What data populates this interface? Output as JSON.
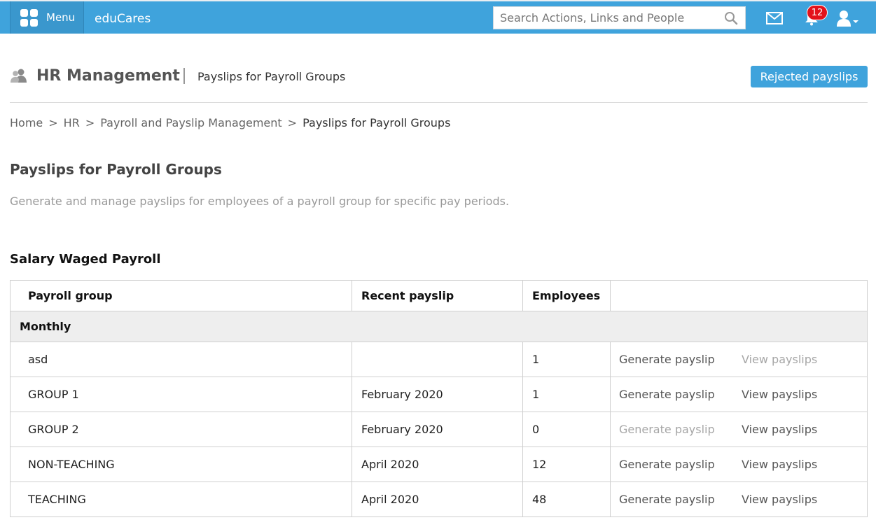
{
  "topbar": {
    "menu_label": "Menu",
    "app_name": "eduCares",
    "search_placeholder": "Search Actions, Links and People",
    "notification_count": "12",
    "icons": [
      "menu-grid-icon",
      "search-icon",
      "mail-icon",
      "bell-icon",
      "user-icon"
    ],
    "accent_color": "#3fa3dc"
  },
  "header": {
    "title": "HR Management",
    "subtitle": "Payslips for Payroll Groups",
    "rejected_button": "Rejected payslips"
  },
  "breadcrumb": [
    {
      "label": "Home"
    },
    {
      "label": "HR"
    },
    {
      "label": "Payroll and Payslip Management"
    },
    {
      "label": "Payslips for Payroll Groups"
    }
  ],
  "breadcrumb_sep": ">",
  "page": {
    "title": "Payslips for Payroll Groups",
    "description": "Generate and manage payslips for employees of a payroll group for specific pay periods."
  },
  "section": {
    "title": "Salary Waged Payroll"
  },
  "table": {
    "headers": [
      "Payroll group",
      "Recent payslip",
      "Employees",
      ""
    ],
    "group_label": "Monthly",
    "generate_label": "Generate payslip",
    "view_label": "View payslips",
    "rows": [
      {
        "name": "asd",
        "recent": "",
        "employees": "1",
        "generate_enabled": true,
        "view_enabled": false
      },
      {
        "name": "GROUP 1",
        "recent": "February 2020",
        "employees": "1",
        "generate_enabled": true,
        "view_enabled": true
      },
      {
        "name": "GROUP 2",
        "recent": "February 2020",
        "employees": "0",
        "generate_enabled": false,
        "view_enabled": true
      },
      {
        "name": "NON-TEACHING",
        "recent": "April 2020",
        "employees": "12",
        "generate_enabled": true,
        "view_enabled": true
      },
      {
        "name": "TEACHING",
        "recent": "April 2020",
        "employees": "48",
        "generate_enabled": true,
        "view_enabled": true
      }
    ]
  }
}
